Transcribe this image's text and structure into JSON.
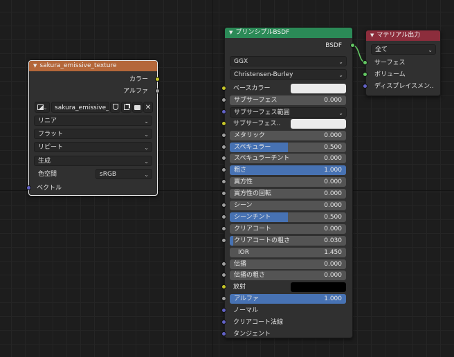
{
  "texture_node": {
    "title": "sakura_emissive_texture",
    "header_color": "#b4673a",
    "outputs": [
      "カラー",
      "アルファ"
    ],
    "image_name": "sakura_emissive_...",
    "interpolation": "リニア",
    "projection": "フラット",
    "extension": "リピート",
    "source": "生成",
    "colorspace_label": "色空間",
    "colorspace_value": "sRGB",
    "input_vector": "ベクトル"
  },
  "bsdf_node": {
    "title": "プリンシプルBSDF",
    "header_color": "#2b8a57",
    "output_label": "BSDF",
    "distribution": "GGX",
    "subsurface_method": "Christensen-Burley",
    "rows": [
      {
        "label": "ベースカラー",
        "type": "color",
        "color": "#ebebeb",
        "socket": "yellow"
      },
      {
        "label": "サブサーフェス",
        "type": "value",
        "value": "0.000",
        "fill": 0,
        "socket": "gray"
      },
      {
        "label": "サブサーフェス範囲",
        "type": "vector",
        "socket": "blue"
      },
      {
        "label": "サブサーフェス..",
        "type": "color",
        "color": "#ebebeb",
        "socket": "yellow"
      },
      {
        "label": "メタリック",
        "type": "value",
        "value": "0.000",
        "fill": 0,
        "socket": "gray"
      },
      {
        "label": "スペキュラー",
        "type": "value",
        "value": "0.500",
        "fill": 0.5,
        "socket": "gray"
      },
      {
        "label": "スペキュラーチント",
        "type": "value",
        "value": "0.000",
        "fill": 0,
        "socket": "gray"
      },
      {
        "label": "粗さ",
        "type": "value",
        "value": "1.000",
        "fill": 1,
        "socket": "gray"
      },
      {
        "label": "異方性",
        "type": "value",
        "value": "0.000",
        "fill": 0,
        "socket": "gray"
      },
      {
        "label": "異方性の回転",
        "type": "value",
        "value": "0.000",
        "fill": 0,
        "socket": "gray"
      },
      {
        "label": "シーン",
        "type": "value",
        "value": "0.000",
        "fill": 0,
        "socket": "gray"
      },
      {
        "label": "シーンチント",
        "type": "value",
        "value": "0.500",
        "fill": 0.5,
        "socket": "gray"
      },
      {
        "label": "クリアコート",
        "type": "value",
        "value": "0.000",
        "fill": 0,
        "socket": "gray"
      },
      {
        "label": "クリアコートの粗さ",
        "type": "value",
        "value": "0.030",
        "fill": 0.03,
        "socket": "gray"
      },
      {
        "label": "IOR",
        "type": "value",
        "value": "1.450",
        "fill": 0,
        "socket": "none"
      },
      {
        "label": "伝播",
        "type": "value",
        "value": "0.000",
        "fill": 0,
        "socket": "gray"
      },
      {
        "label": "伝播の粗さ",
        "type": "value",
        "value": "0.000",
        "fill": 0,
        "socket": "gray"
      },
      {
        "label": "放射",
        "type": "color",
        "color": "#000000",
        "socket": "yellow"
      },
      {
        "label": "アルファ",
        "type": "value",
        "value": "1.000",
        "fill": 1,
        "socket": "gray"
      },
      {
        "label": "ノーマル",
        "type": "vector",
        "socket": "blue"
      },
      {
        "label": "クリアコート法線",
        "type": "vector",
        "socket": "blue"
      },
      {
        "label": "タンジェント",
        "type": "vector",
        "socket": "blue"
      }
    ]
  },
  "output_node": {
    "title": "マテリアル出力",
    "header_color": "#8c2d3c",
    "target": "全て",
    "inputs": [
      {
        "label": "サーフェス",
        "socket": "green"
      },
      {
        "label": "ボリューム",
        "socket": "green"
      },
      {
        "label": "ディスプレイスメン..",
        "socket": "blue"
      }
    ]
  }
}
